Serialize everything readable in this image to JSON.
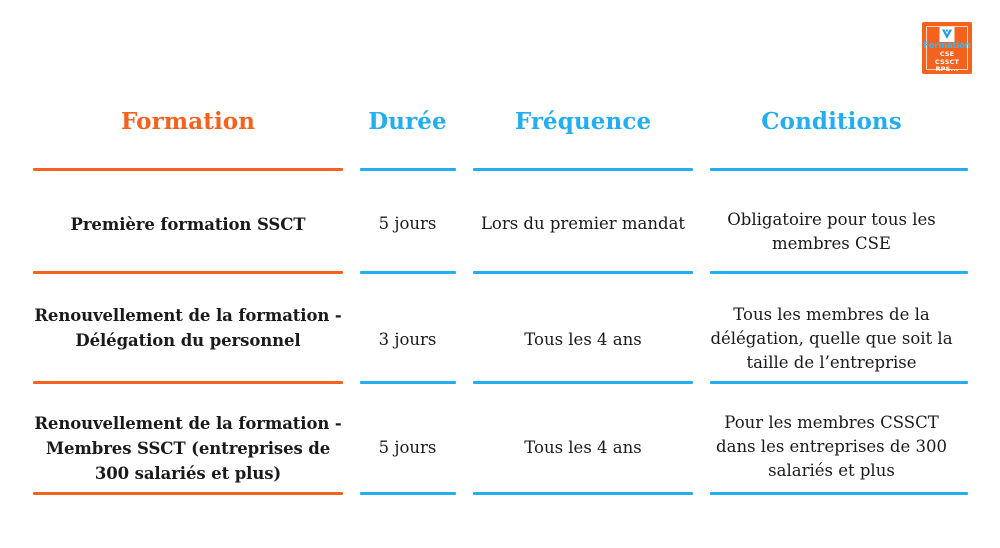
{
  "logo": {
    "name": "formation-cse-cssct-rps-logo",
    "brand_word": "Formation",
    "line1": "CSE",
    "line2": "CSSCT",
    "line3": "RPS...",
    "bird_icon": "bird-mark-icon",
    "square_color": "#F4631E",
    "word_color": "#3FB5EF",
    "text_color": "#FFFFFF"
  },
  "colors": {
    "orange": "#F4631E",
    "blue": "#22AEF0",
    "text": "#1A1A1A",
    "background": "#FFFFFF"
  },
  "table": {
    "headers": [
      {
        "label": "Formation",
        "color": "#F4631E"
      },
      {
        "label": "Durée",
        "color": "#22AEF0"
      },
      {
        "label": "Fréquence",
        "color": "#22AEF0"
      },
      {
        "label": "Conditions",
        "color": "#22AEF0"
      }
    ],
    "rows": [
      {
        "formation": "Première formation SSCT",
        "duree": "5 jours",
        "frequence": "Lors du premier mandat",
        "conditions": "Obligatoire pour tous les membres CSE"
      },
      {
        "formation": "Renouvellement de la formation - Délégation du personnel",
        "duree": "3 jours",
        "frequence": "Tous les 4 ans",
        "conditions": "Tous les membres de la délégation, quelle que soit la taille de l’entreprise"
      },
      {
        "formation": "Renouvellement de la formation - Membres SSCT (entreprises de 300 salariés et plus)",
        "duree": "5 jours",
        "frequence": "Tous les 4 ans",
        "conditions": "Pour les membres CSSCT dans les entreprises de 300 salariés et plus"
      }
    ]
  }
}
